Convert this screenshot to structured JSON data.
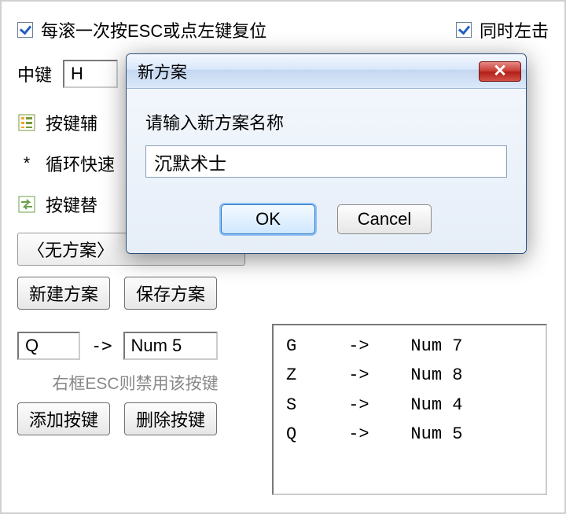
{
  "top": {
    "reset_checkbox_label": "每滚一次按ESC或点左键复位",
    "reset_checked": true,
    "leftclick_checkbox_label": "同时左击",
    "leftclick_checked": true
  },
  "middle": {
    "label": "中键",
    "value": "H"
  },
  "sections": {
    "key_assist": "按键辅",
    "cycle_fast_prefix": "*",
    "cycle_fast": "循环快速",
    "key_replace": "按键替"
  },
  "scheme": {
    "select_value": "〈无方案〉",
    "new_btn": "新建方案",
    "save_btn": "保存方案"
  },
  "mapping": {
    "source_value": "Q",
    "arrow": "->",
    "target_value": "Num 5",
    "hint": "右框ESC则禁用该按键",
    "add_btn": "添加按键",
    "del_btn": "删除按键",
    "list": [
      {
        "src": "G",
        "arrow": "->",
        "dst": "Num 7"
      },
      {
        "src": "Z",
        "arrow": "->",
        "dst": "Num 8"
      },
      {
        "src": "S",
        "arrow": "->",
        "dst": "Num 4"
      },
      {
        "src": "Q",
        "arrow": "->",
        "dst": "Num 5"
      }
    ]
  },
  "dialog": {
    "title": "新方案",
    "prompt": "请输入新方案名称",
    "input_value": "沉默术士",
    "ok": "OK",
    "cancel": "Cancel",
    "close_glyph": "✕"
  }
}
